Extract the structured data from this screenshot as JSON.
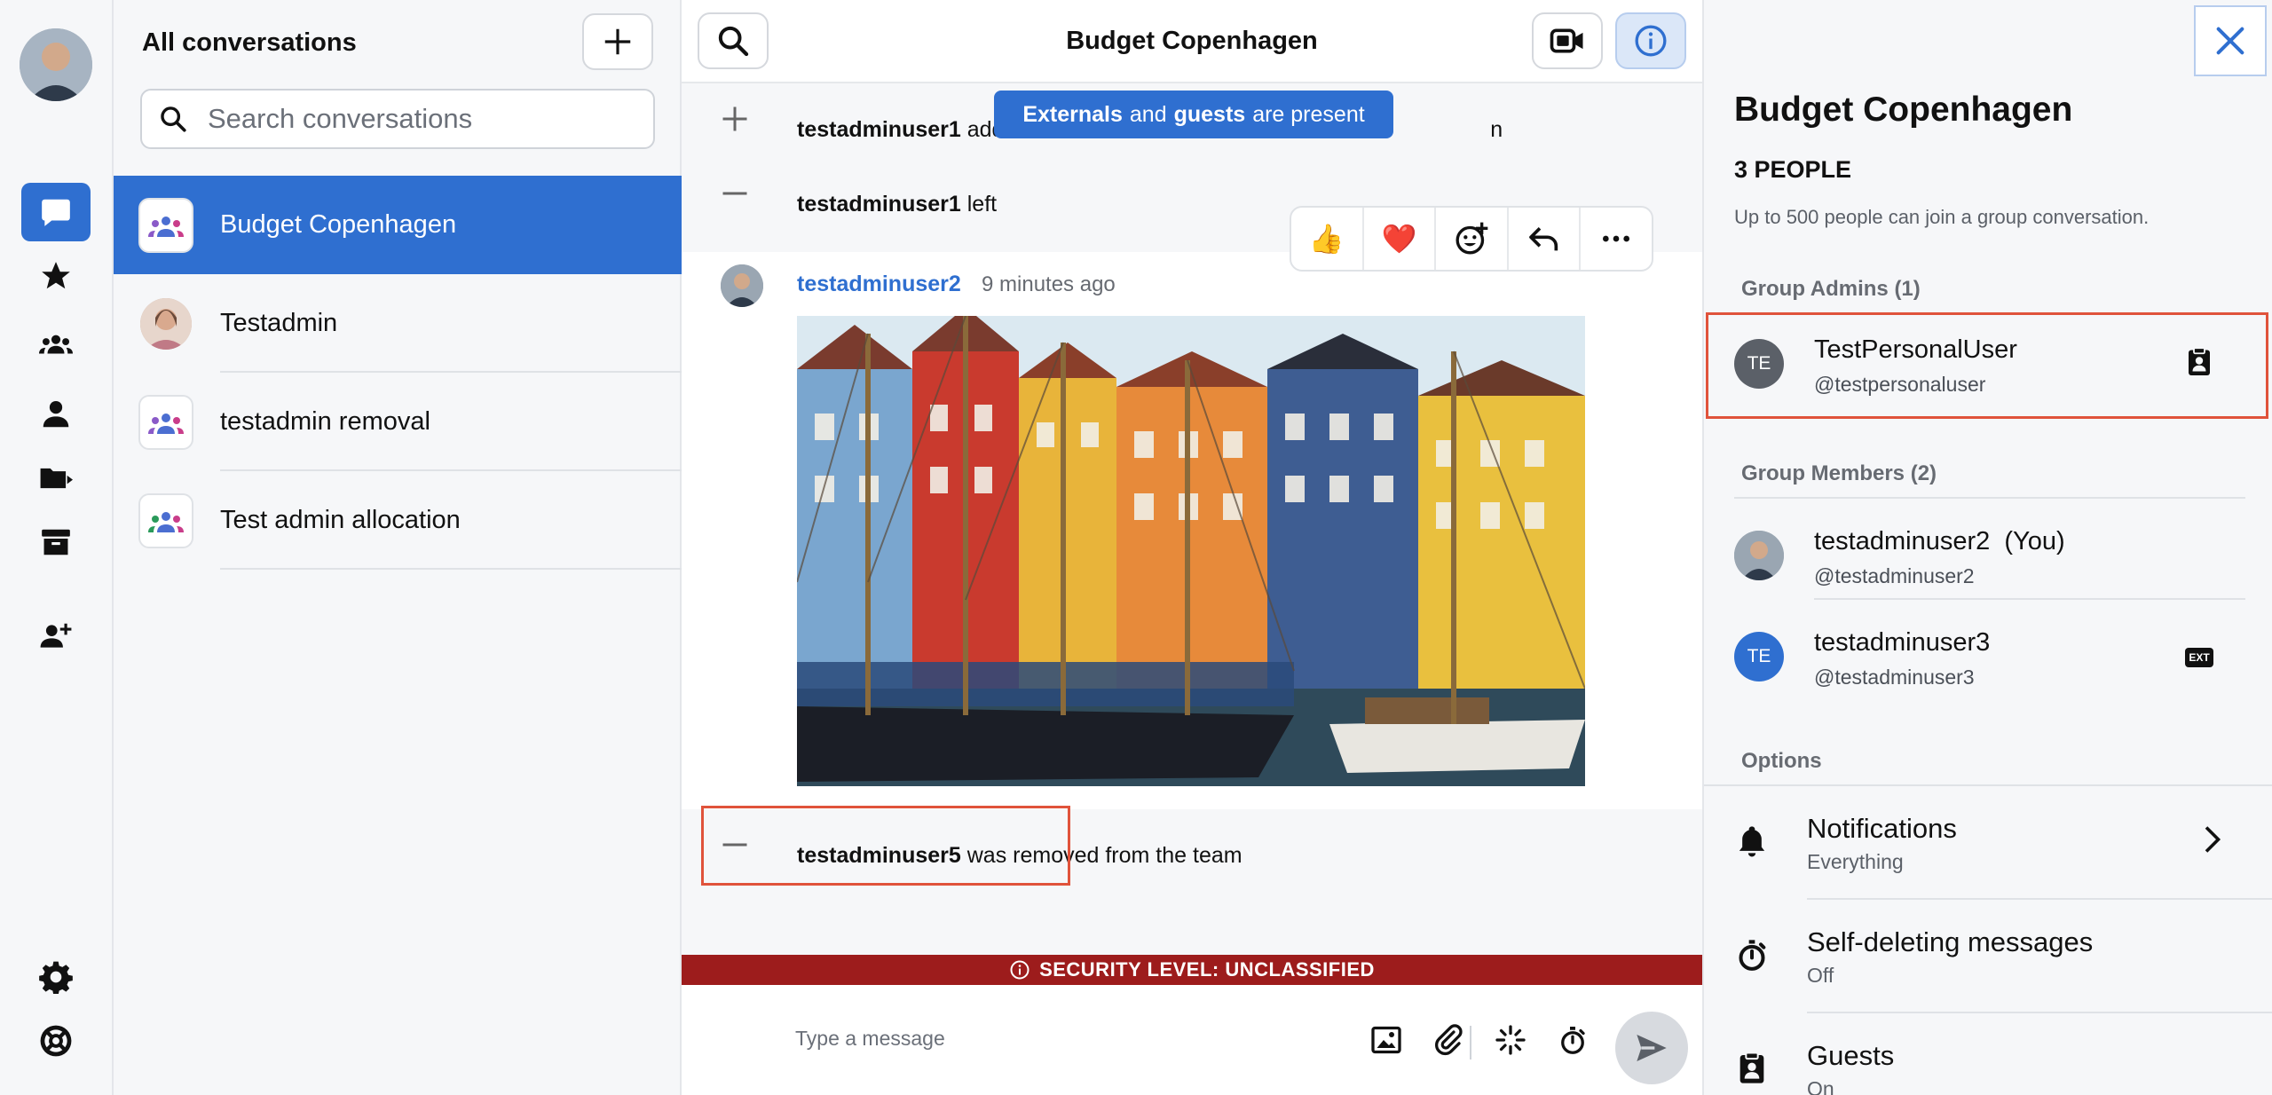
{
  "sidebar": {
    "nav": [
      "conversations",
      "favorites",
      "groups",
      "people",
      "folders",
      "archive",
      "connect",
      "settings",
      "support"
    ]
  },
  "conversations": {
    "title": "All conversations",
    "search_placeholder": "Search conversations",
    "items": [
      {
        "label": "Budget Copenhagen",
        "type": "group",
        "active": true
      },
      {
        "label": "Testadmin",
        "type": "person",
        "active": false
      },
      {
        "label": "testadmin removal",
        "type": "group",
        "active": false
      },
      {
        "label": "Test admin allocation",
        "type": "group",
        "active": false
      }
    ]
  },
  "chat": {
    "title": "Budget Copenhagen",
    "banner": {
      "externals": "Externals",
      "and": "and",
      "guests": "guests",
      "present": "are present"
    },
    "system1": {
      "user": "testadminuser1",
      "text": "added",
      "tail": "n"
    },
    "system2": {
      "user": "testadminuser1",
      "text": "left"
    },
    "message": {
      "sender": "testadminuser2",
      "time": "9 minutes ago"
    },
    "reactions": [
      "👍",
      "❤️"
    ],
    "system3": {
      "user": "testadminuser5",
      "text": "was removed from the team"
    },
    "security": "SECURITY LEVEL: UNCLASSIFIED",
    "composer_placeholder": "Type a message"
  },
  "details": {
    "title": "Budget Copenhagen",
    "people_count": "3 PEOPLE",
    "description": "Up to 500 people can join a group conversation.",
    "admins_header": "Group Admins (1)",
    "admins": [
      {
        "initials": "TE",
        "name": "TestPersonalUser",
        "handle": "@testpersonaluser"
      }
    ],
    "members_header": "Group Members (2)",
    "members": [
      {
        "initials": "",
        "name": "testadminuser2  (You)",
        "handle": "@testadminuser2"
      },
      {
        "initials": "TE",
        "name": "testadminuser3",
        "handle": "@testadminuser3",
        "badge": "EXT"
      }
    ],
    "options_header": "Options",
    "options": [
      {
        "title": "Notifications",
        "sub": "Everything"
      },
      {
        "title": "Self-deleting messages",
        "sub": "Off"
      },
      {
        "title": "Guests",
        "sub": "On"
      }
    ]
  },
  "colors": {
    "accent": "#2f6fd0",
    "security": "#9d1c1c",
    "highlight": "#e0533b"
  }
}
